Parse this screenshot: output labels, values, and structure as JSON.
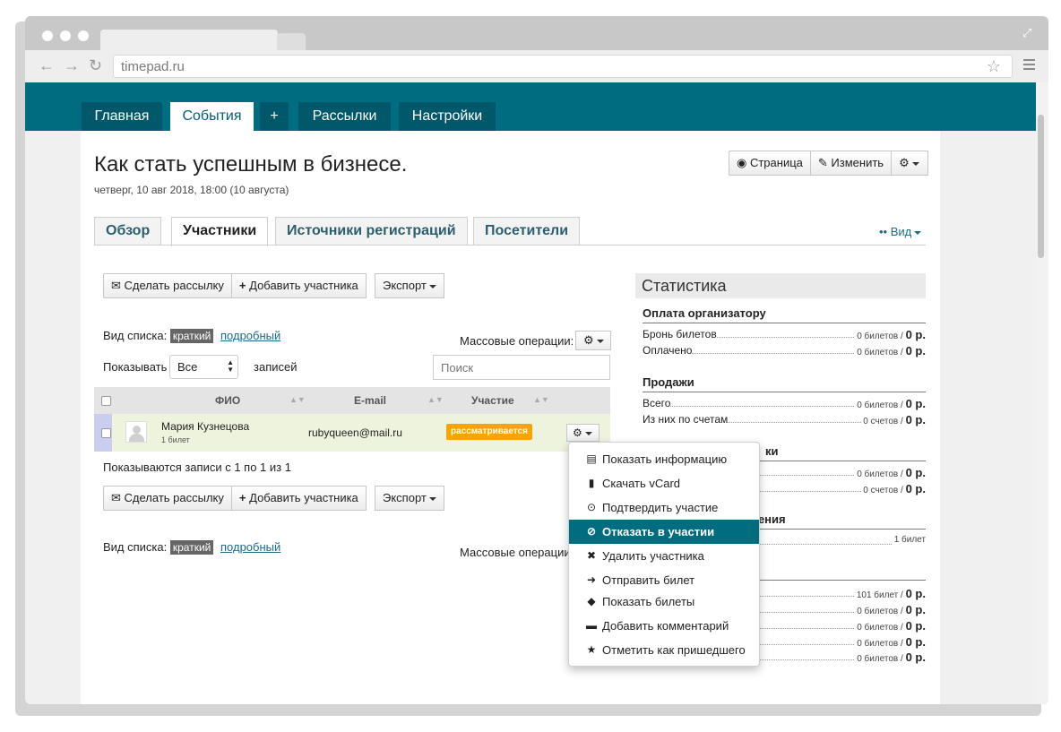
{
  "browser": {
    "url": "timepad.ru"
  },
  "topnav": {
    "tabs": [
      {
        "label": "Главная"
      },
      {
        "label": "События"
      },
      {
        "label": "+"
      },
      {
        "label": "Рассылки"
      },
      {
        "label": "Настройки"
      }
    ]
  },
  "event": {
    "title": "Как стать успешным в бизнесе.",
    "datetime": "четверг, 10 авг 2018, 18:00 (10 августа)"
  },
  "header_actions": {
    "page": "Страница",
    "edit": "Изменить"
  },
  "content_tabs": [
    {
      "label": "Обзор"
    },
    {
      "label": "Участники"
    },
    {
      "label": "Источники регистраций"
    },
    {
      "label": "Посетители"
    }
  ],
  "view_label": "Вид",
  "toolbar": {
    "mailing": "Сделать рассылку",
    "add": "Добавить участника",
    "export": "Экспорт"
  },
  "list_view": {
    "label": "Вид списка:",
    "brief": "краткий",
    "detailed": "подробный"
  },
  "bulk_ops": "Массовые операции:",
  "show": {
    "prefix": "Показывать",
    "value": "Все",
    "suffix": "записей"
  },
  "search": {
    "placeholder": "Поиск"
  },
  "table": {
    "columns": [
      "ФИО",
      "E-mail",
      "Участие"
    ],
    "rows": [
      {
        "name": "Мария Кузнецова",
        "tickets": "1 билет",
        "email": "rubyqueen@mail.ru",
        "status": "рассматривается"
      }
    ],
    "footer": "Показываются записи с 1 по 1 из 1"
  },
  "stats": {
    "title": "Статистика",
    "sections": [
      {
        "heading": "Оплата организатору",
        "rows": [
          {
            "label": "Бронь билетов",
            "count": "0 билетов /",
            "amount": "0 р."
          },
          {
            "label": "Оплачено",
            "count": "0 билетов /",
            "amount": "0 р."
          }
        ]
      },
      {
        "heading": "Продажи",
        "rows": [
          {
            "label": "Всего",
            "count": "0 билетов /",
            "amount": "0 р."
          },
          {
            "label": "Из них по счетам",
            "count": "0 счетов /",
            "amount": "0 р."
          }
        ]
      },
      {
        "heading_partial": "ки",
        "rows": [
          {
            "count": "0 билетов /",
            "amount": "0 р."
          },
          {
            "count": "0 счетов /",
            "amount": "0 р."
          }
        ]
      },
      {
        "heading_partial": "рения",
        "rows": [
          {
            "count": "1 билет",
            "amount": ""
          }
        ]
      },
      {
        "rows": [
          {
            "count": "101 билет /",
            "amount": "0 р."
          },
          {
            "count": "0 билетов /",
            "amount": "0 р."
          },
          {
            "count": "0 билетов /",
            "amount": "0 р."
          },
          {
            "count": "0 билетов /",
            "amount": "0 р."
          },
          {
            "count": "0 билетов /",
            "amount": "0 р."
          }
        ]
      }
    ]
  },
  "dropdown": {
    "items": [
      {
        "label": "Показать информацию",
        "icon": "list-icon"
      },
      {
        "label": "Скачать vCard",
        "icon": "file-icon"
      },
      {
        "label": "Подтвердить участие",
        "icon": "check-circle-icon"
      },
      {
        "label": "Отказать в участии",
        "icon": "ban-icon"
      },
      {
        "label": "Удалить участника",
        "icon": "x-icon"
      },
      {
        "label": "Отправить билет",
        "icon": "arrow-right-icon"
      },
      {
        "label": "Показать билеты",
        "icon": "tags-icon"
      },
      {
        "label": "Добавить комментарий",
        "icon": "comment-icon"
      },
      {
        "label": "Отметить как пришедшего",
        "icon": "star-icon"
      }
    ]
  }
}
